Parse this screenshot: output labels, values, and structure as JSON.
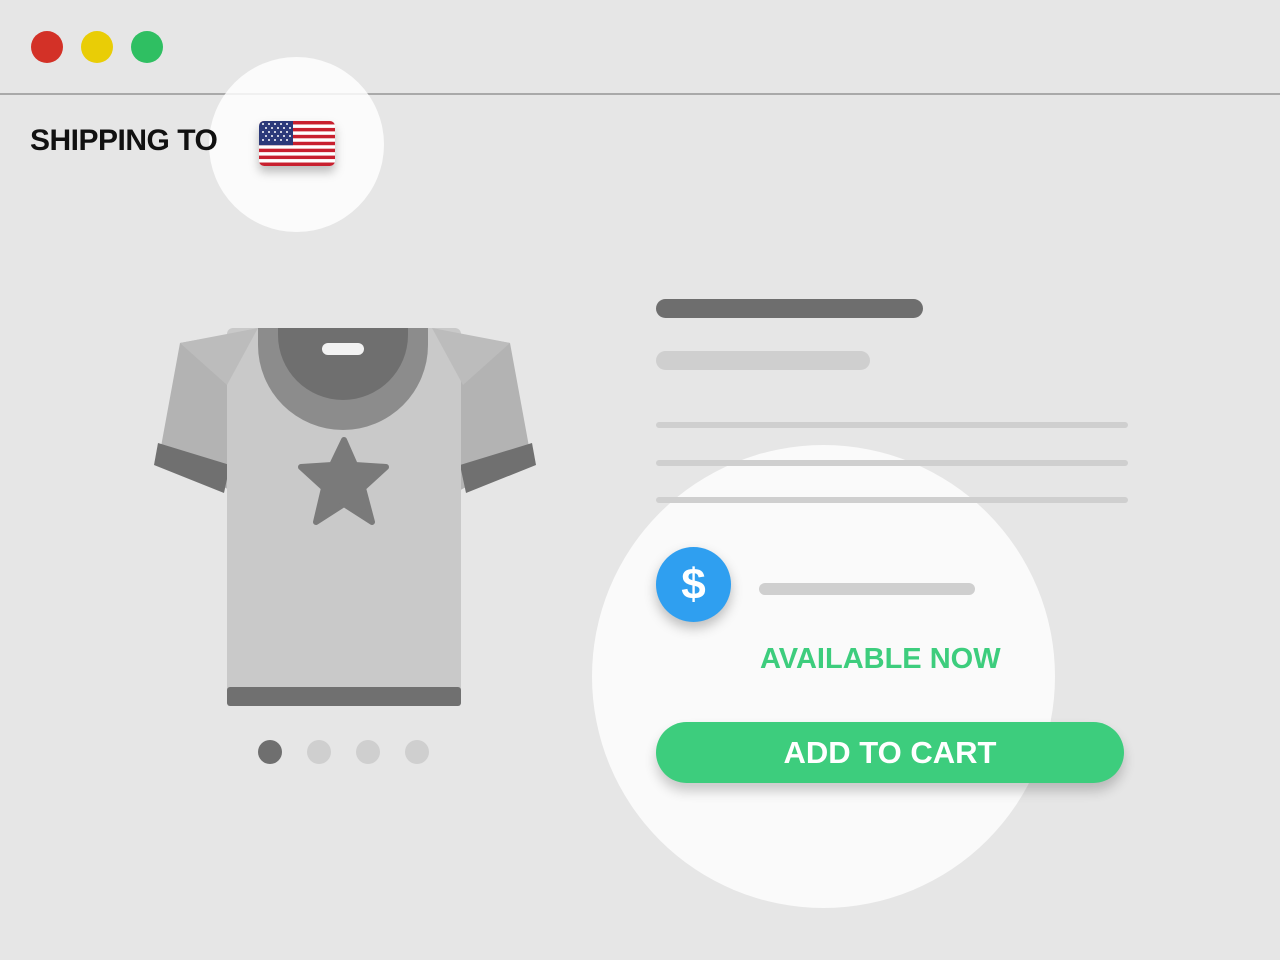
{
  "window": {
    "controls": [
      {
        "name": "close",
        "color": "#d33127"
      },
      {
        "name": "minimize",
        "color": "#e9cd06"
      },
      {
        "name": "maximize",
        "color": "#2fbf62"
      }
    ]
  },
  "shipping": {
    "label": "SHIPPING TO",
    "country_icon": "us-flag-icon"
  },
  "product": {
    "image_icon": "tshirt-icon",
    "carousel": {
      "count": 4,
      "active_index": 0
    }
  },
  "purchase": {
    "price_icon": "dollar-icon",
    "price_symbol": "$",
    "availability": "AVAILABLE NOW",
    "cta_label": "ADD TO CART"
  },
  "colors": {
    "accent_green": "#3dcd7d",
    "accent_blue": "#2f9ff0",
    "background": "#e6e6e6"
  }
}
